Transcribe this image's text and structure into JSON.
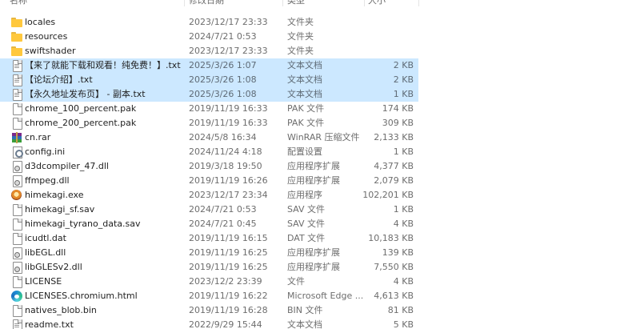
{
  "columns": {
    "name": "名称",
    "date": "修改日期",
    "type": "类型",
    "size": "大小"
  },
  "files": [
    {
      "name": "locales",
      "date": "2023/12/17 23:33",
      "type": "文件夹",
      "size": "",
      "icon": "folder-icon",
      "selected": false
    },
    {
      "name": "resources",
      "date": "2024/7/21 0:53",
      "type": "文件夹",
      "size": "",
      "icon": "folder-icon",
      "selected": false
    },
    {
      "name": "swiftshader",
      "date": "2023/12/17 23:33",
      "type": "文件夹",
      "size": "",
      "icon": "folder-icon",
      "selected": false
    },
    {
      "name": "【来了就能下载和观看！纯免费！】.txt",
      "date": "2025/3/26 1:07",
      "type": "文本文档",
      "size": "2 KB",
      "icon": "text-file-icon",
      "selected": true
    },
    {
      "name": "【论坛介绍】.txt",
      "date": "2025/3/26 1:08",
      "type": "文本文档",
      "size": "2 KB",
      "icon": "text-file-icon",
      "selected": true
    },
    {
      "name": "【永久地址发布页】 - 副本.txt",
      "date": "2025/3/26 1:08",
      "type": "文本文档",
      "size": "1 KB",
      "icon": "text-file-icon",
      "selected": true
    },
    {
      "name": "chrome_100_percent.pak",
      "date": "2019/11/19 16:33",
      "type": "PAK 文件",
      "size": "174 KB",
      "icon": "file-icon",
      "selected": false
    },
    {
      "name": "chrome_200_percent.pak",
      "date": "2019/11/19 16:33",
      "type": "PAK 文件",
      "size": "309 KB",
      "icon": "file-icon",
      "selected": false
    },
    {
      "name": "cn.rar",
      "date": "2024/5/8 16:34",
      "type": "WinRAR 压缩文件",
      "size": "2,133 KB",
      "icon": "winrar-archive-icon",
      "selected": false
    },
    {
      "name": "config.ini",
      "date": "2024/11/24 4:18",
      "type": "配置设置",
      "size": "1 KB",
      "icon": "config-file-icon",
      "selected": false
    },
    {
      "name": "d3dcompiler_47.dll",
      "date": "2019/3/18 19:50",
      "type": "应用程序扩展",
      "size": "4,377 KB",
      "icon": "dll-file-icon",
      "selected": false
    },
    {
      "name": "ffmpeg.dll",
      "date": "2019/11/19 16:26",
      "type": "应用程序扩展",
      "size": "2,079 KB",
      "icon": "dll-file-icon",
      "selected": false
    },
    {
      "name": "himekagi.exe",
      "date": "2023/12/17 23:34",
      "type": "应用程序",
      "size": "102,201 KB",
      "icon": "app-exe-icon",
      "selected": false
    },
    {
      "name": "himekagi_sf.sav",
      "date": "2024/7/21 0:53",
      "type": "SAV 文件",
      "size": "1 KB",
      "icon": "file-icon",
      "selected": false
    },
    {
      "name": "himekagi_tyrano_data.sav",
      "date": "2024/7/21 0:45",
      "type": "SAV 文件",
      "size": "4 KB",
      "icon": "file-icon",
      "selected": false
    },
    {
      "name": "icudtl.dat",
      "date": "2019/11/19 16:15",
      "type": "DAT 文件",
      "size": "10,183 KB",
      "icon": "file-icon",
      "selected": false
    },
    {
      "name": "libEGL.dll",
      "date": "2019/11/19 16:25",
      "type": "应用程序扩展",
      "size": "139 KB",
      "icon": "dll-file-icon",
      "selected": false
    },
    {
      "name": "libGLESv2.dll",
      "date": "2019/11/19 16:25",
      "type": "应用程序扩展",
      "size": "7,550 KB",
      "icon": "dll-file-icon",
      "selected": false
    },
    {
      "name": "LICENSE",
      "date": "2023/12/2 23:39",
      "type": "文件",
      "size": "4 KB",
      "icon": "file-icon",
      "selected": false
    },
    {
      "name": "LICENSES.chromium.html",
      "date": "2019/11/19 16:22",
      "type": "Microsoft Edge ...",
      "size": "4,613 KB",
      "icon": "edge-html-icon",
      "selected": false
    },
    {
      "name": "natives_blob.bin",
      "date": "2019/11/19 16:28",
      "type": "BIN 文件",
      "size": "81 KB",
      "icon": "file-icon",
      "selected": false
    },
    {
      "name": "readme.txt",
      "date": "2022/9/29 15:44",
      "type": "文本文档",
      "size": "5 KB",
      "icon": "text-file-icon",
      "selected": false
    }
  ],
  "colors": {
    "selection": "#cce8ff",
    "folder": "#ffc83d"
  }
}
